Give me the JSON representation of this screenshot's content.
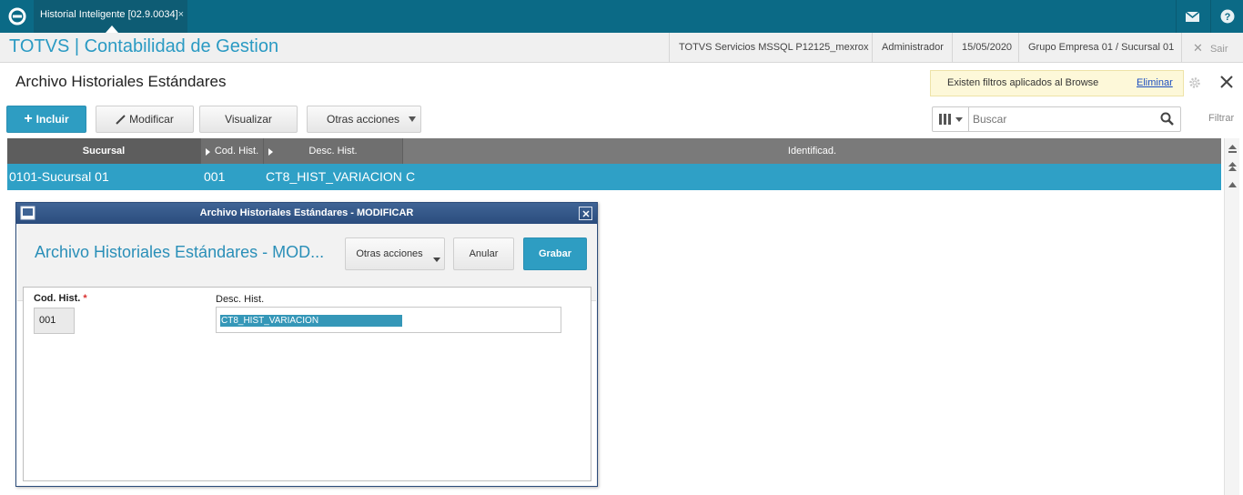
{
  "topbar": {
    "tab_label": "Historial Inteligente [02.9.0034]",
    "tab_close": "×",
    "colors": {
      "bar": "#0b6a86",
      "tab": "#0e5c74"
    }
  },
  "header": {
    "app_title": "TOTVS | Contabilidad de Gestion",
    "environment": "TOTVS Servicios MSSQL P12125_mexrox",
    "user": "Administrador",
    "date": "15/05/2020",
    "company": "Grupo Empresa 01 / Sucursal 01",
    "exit_label": "Sair"
  },
  "page": {
    "title": "Archivo Historiales Estándares",
    "filter_notice": "Existen filtros aplicados al Browse",
    "filter_remove": "Eliminar"
  },
  "toolbar": {
    "include": "Incluir",
    "modify": "Modificar",
    "view": "Visualizar",
    "other_actions": "Otras acciones",
    "search_placeholder": "Buscar",
    "filter": "Filtrar"
  },
  "grid": {
    "columns": [
      "Sucursal",
      "Cod. Hist.",
      "Desc. Hist.",
      "Identificad."
    ],
    "rows": [
      {
        "sucursal": "0101-Sucursal 01",
        "cod": "001",
        "desc": "CT8_HIST_VARIACION",
        "ident": "C"
      }
    ],
    "colors": {
      "selected_row": "#2fa0c6",
      "header": "#7a7a7a"
    }
  },
  "modal": {
    "window_title": "Archivo Historiales Estándares - MODIFICAR",
    "heading": "Archivo Historiales Estándares - MOD...",
    "other_actions": "Otras acciones",
    "cancel": "Anular",
    "save": "Grabar",
    "fields": {
      "code_label": "Cod. Hist.",
      "code_required": "*",
      "code_value": "001",
      "desc_label": "Desc. Hist.",
      "desc_value": "CT8_HIST_VARIACION"
    }
  }
}
